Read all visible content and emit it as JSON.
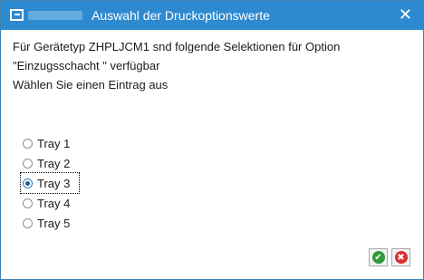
{
  "window": {
    "title": "Auswahl der Druckoptionswerte",
    "close_symbol": "✕"
  },
  "message": {
    "line1": "Für Gerätetyp ZHPLJCM1 snd folgende Selektionen für Option",
    "line2": "\"Einzugsschacht \" verfügbar",
    "line3": "Wählen Sie einen Eintrag aus"
  },
  "options": [
    {
      "label": "Tray 1",
      "selected": false
    },
    {
      "label": "Tray 2",
      "selected": false
    },
    {
      "label": "Tray 3",
      "selected": true
    },
    {
      "label": "Tray 4",
      "selected": false
    },
    {
      "label": "Tray 5",
      "selected": false
    }
  ],
  "buttons": {
    "ok_symbol": "✔",
    "cancel_symbol": "✖"
  },
  "colors": {
    "titlebar": "#2e8ad0",
    "ok": "#2e9a3c",
    "cancel": "#d83030"
  },
  "icons": {
    "app": "sap-screen-icon",
    "close": "close-icon",
    "ok": "check-icon",
    "cancel": "cancel-icon"
  }
}
